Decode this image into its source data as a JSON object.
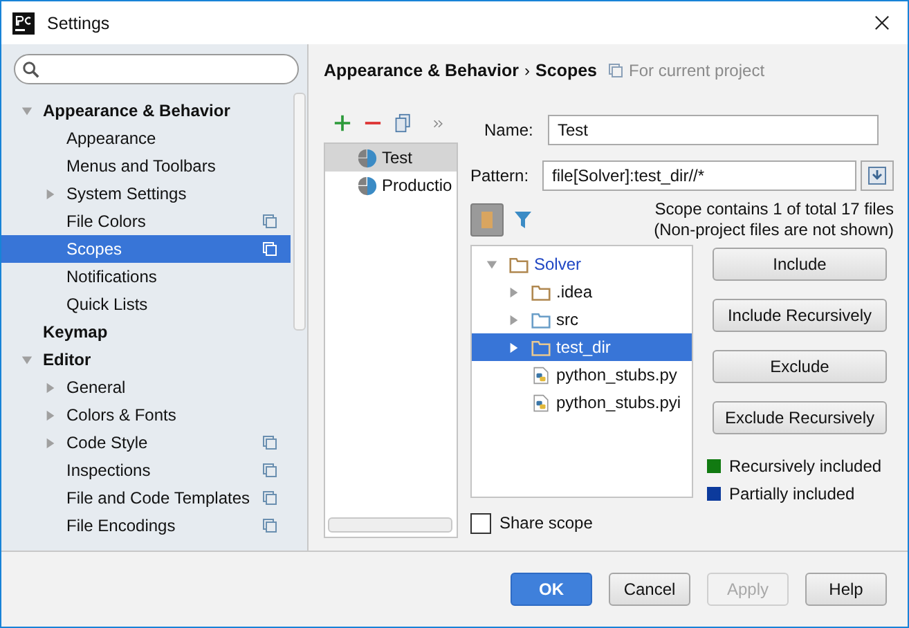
{
  "window": {
    "title": "Settings"
  },
  "sidebar": {
    "items": [
      {
        "label": "Appearance & Behavior",
        "bold": true,
        "expanded": true,
        "selected": false,
        "project_level": false,
        "children": [
          {
            "label": "Appearance",
            "selected": false,
            "project_level": false
          },
          {
            "label": "Menus and Toolbars",
            "selected": false,
            "project_level": false
          },
          {
            "label": "System Settings",
            "expanded": false,
            "selected": false,
            "project_level": false
          },
          {
            "label": "File Colors",
            "selected": false,
            "project_level": true
          },
          {
            "label": "Scopes",
            "selected": true,
            "project_level": true
          },
          {
            "label": "Notifications",
            "selected": false,
            "project_level": false
          },
          {
            "label": "Quick Lists",
            "selected": false,
            "project_level": false
          }
        ]
      },
      {
        "label": "Keymap",
        "bold": true,
        "selected": false,
        "project_level": false
      },
      {
        "label": "Editor",
        "bold": true,
        "expanded": true,
        "selected": false,
        "project_level": false,
        "children": [
          {
            "label": "General",
            "expanded": false,
            "selected": false,
            "project_level": false
          },
          {
            "label": "Colors & Fonts",
            "expanded": false,
            "selected": false,
            "project_level": false
          },
          {
            "label": "Code Style",
            "expanded": false,
            "selected": false,
            "project_level": true
          },
          {
            "label": "Inspections",
            "selected": false,
            "project_level": true
          },
          {
            "label": "File and Code Templates",
            "selected": false,
            "project_level": true
          },
          {
            "label": "File Encodings",
            "selected": false,
            "project_level": true
          }
        ]
      }
    ]
  },
  "breadcrumb": {
    "parts": [
      "Appearance & Behavior",
      "Scopes"
    ],
    "separator": "›",
    "note": "For current project"
  },
  "scopes": {
    "items": [
      {
        "name": "Test",
        "selected": true
      },
      {
        "name": "Productio",
        "selected": false
      }
    ]
  },
  "form": {
    "name_label": "Name:",
    "name_value": "Test",
    "pattern_label": "Pattern:",
    "pattern_value": "file[Solver]:test_dir//*",
    "summary": [
      "Scope contains 1 of total 17 files",
      "(Non-project files are not shown)"
    ],
    "flatten_toggle": {
      "on": true
    }
  },
  "file_tree": {
    "items": [
      {
        "name": "Solver",
        "kind": "folder",
        "expanded": true,
        "selected": false,
        "partial": true,
        "children": [
          {
            "name": ".idea",
            "kind": "folder",
            "expanded": false,
            "selected": false,
            "partial": false
          },
          {
            "name": "src",
            "kind": "source_folder",
            "expanded": false,
            "selected": false,
            "partial": false
          },
          {
            "name": "test_dir",
            "kind": "folder",
            "expanded": false,
            "selected": true,
            "partial": false
          },
          {
            "name": "python_stubs.py",
            "kind": "python_file",
            "selected": false,
            "partial": false
          },
          {
            "name": "python_stubs.pyi",
            "kind": "python_file",
            "selected": false,
            "partial": false
          }
        ]
      }
    ]
  },
  "actions": [
    "Include",
    "Include Recursively",
    "Exclude",
    "Exclude Recursively"
  ],
  "legend": [
    {
      "label": "Recursively included",
      "color": "#117a11"
    },
    {
      "label": "Partially included",
      "color": "#0c3a9c"
    }
  ],
  "share_scope": {
    "label": "Share scope",
    "checked": false
  },
  "footer_buttons": [
    {
      "label": "OK",
      "default": true,
      "disabled": false
    },
    {
      "label": "Cancel",
      "default": false,
      "disabled": false
    },
    {
      "label": "Apply",
      "default": false,
      "disabled": true
    },
    {
      "label": "Help",
      "default": false,
      "disabled": false
    }
  ]
}
